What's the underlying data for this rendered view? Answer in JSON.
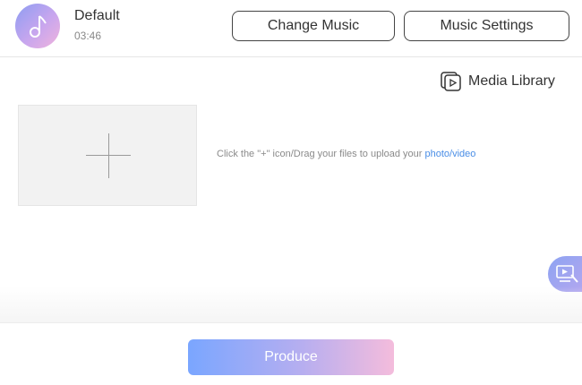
{
  "music": {
    "title": "Default",
    "duration": "03:46",
    "icon": "music-note-icon"
  },
  "header": {
    "change_music_label": "Change Music",
    "music_settings_label": "Music Settings"
  },
  "media_library": {
    "label": "Media Library",
    "icon": "media-library-icon"
  },
  "upload": {
    "icon": "plus-icon",
    "hint_text": "Click the \"+\" icon/Drag your files to upload your ",
    "hint_link": "photo/video"
  },
  "floating": {
    "icon": "screen-record-icon"
  },
  "footer": {
    "produce_label": "Produce"
  },
  "colors": {
    "link": "#4a8ee6",
    "gradient_start": "#7aa6ff",
    "gradient_end": "#f4bcdc"
  }
}
